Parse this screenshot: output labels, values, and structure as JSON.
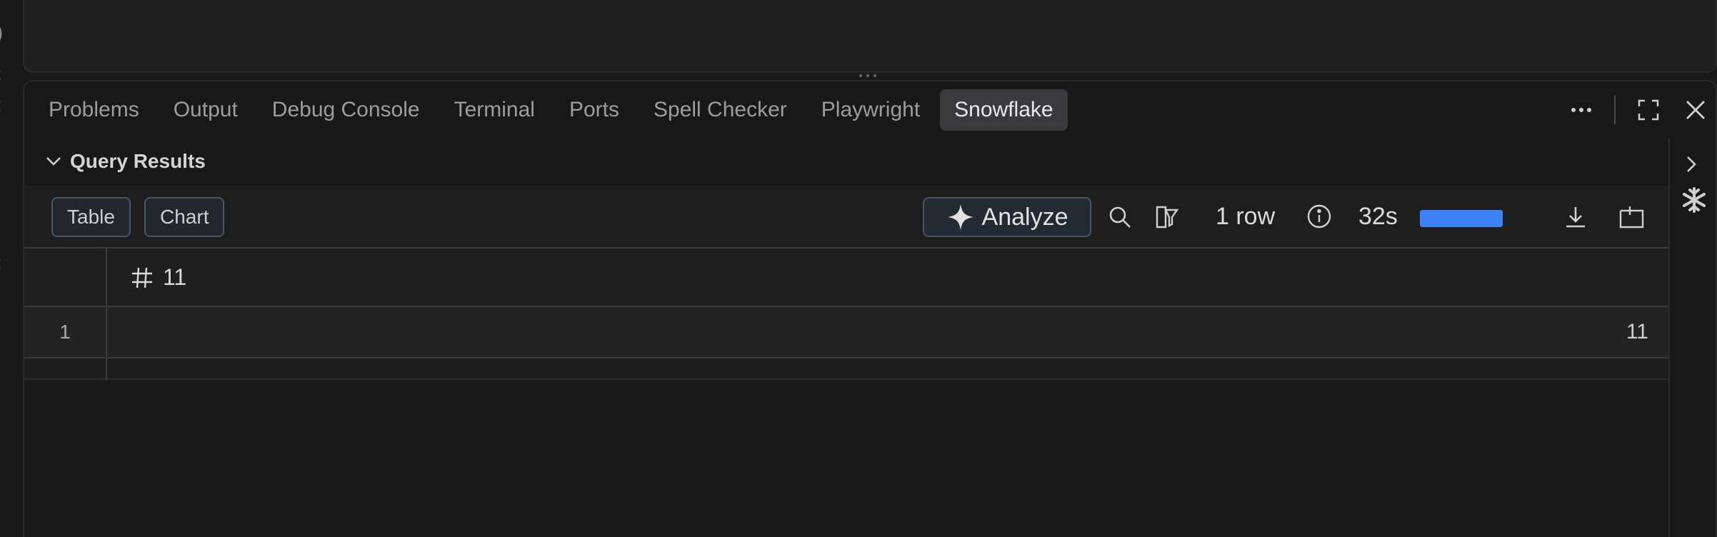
{
  "tabs": [
    {
      "label": "Problems",
      "active": false
    },
    {
      "label": "Output",
      "active": false
    },
    {
      "label": "Debug Console",
      "active": false
    },
    {
      "label": "Terminal",
      "active": false
    },
    {
      "label": "Ports",
      "active": false
    },
    {
      "label": "Spell Checker",
      "active": false
    },
    {
      "label": "Playwright",
      "active": false
    },
    {
      "label": "Snowflake",
      "active": true
    }
  ],
  "panel_actions": {
    "more_icon": "ellipsis-icon",
    "maximize_icon": "maximize-icon",
    "close_icon": "close-icon"
  },
  "section": {
    "title": "Query Results",
    "expanded": true
  },
  "toolbar": {
    "view_toggles": [
      "Table",
      "Chart"
    ],
    "analyze_label": "Analyze",
    "row_count": "1 row",
    "elapsed": "32s",
    "progress": 1.0,
    "progress_color": "#3b82f6"
  },
  "grid": {
    "columns": [
      {
        "type_icon": "hash-icon",
        "name": "11"
      }
    ],
    "rows": [
      {
        "index": "1",
        "values": [
          "11"
        ]
      }
    ]
  },
  "left_strip_glyphs": [
    ")",
    ":",
    "ꜱ"
  ]
}
